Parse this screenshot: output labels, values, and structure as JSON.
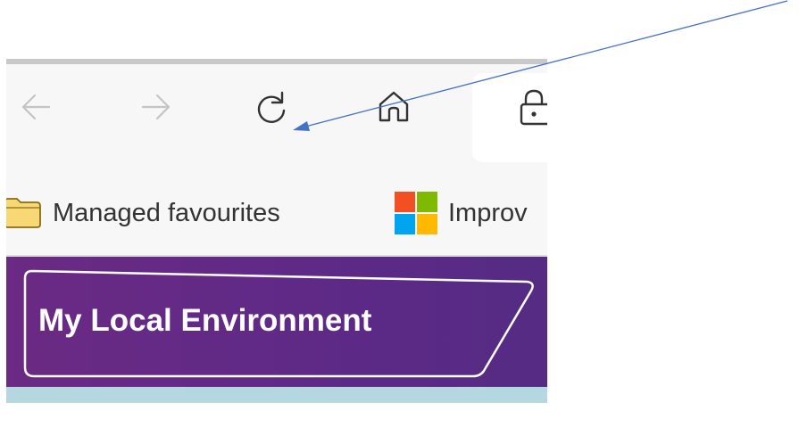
{
  "browser": {
    "toolbar": {
      "buttons": [
        {
          "name": "back-button",
          "icon": "arrow-left-icon"
        },
        {
          "name": "forward-button",
          "icon": "arrow-right-icon"
        },
        {
          "name": "refresh-button",
          "icon": "refresh-icon"
        },
        {
          "name": "home-button",
          "icon": "home-icon"
        }
      ],
      "address_bar_icon": "lock-icon"
    },
    "favourites_bar": {
      "items": [
        {
          "label": "Managed favourites",
          "icon": "folder-icon"
        },
        {
          "label": "Improv",
          "icon": "microsoft-logo-icon"
        }
      ]
    }
  },
  "page": {
    "banner_title": "My Local Environment"
  },
  "annotation": {
    "type": "arrow",
    "points_to": "refresh-button",
    "color": "#4472c4"
  },
  "colors": {
    "banner_purple": "#5d2a86",
    "toolbar_bg": "#f7f7f7",
    "strip_blue": "#b4d7e0",
    "ms_red": "#f25022",
    "ms_green": "#7fba00",
    "ms_blue": "#00a4ef",
    "ms_yellow": "#ffb900"
  }
}
